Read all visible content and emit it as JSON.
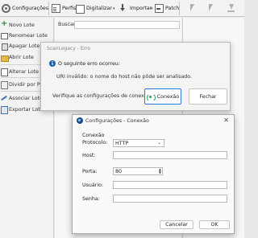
{
  "toolbar": {
    "configuracoes": "Configurações",
    "perfis": "Perfis",
    "digitalizar": "Digitalizar",
    "importar": "Importar",
    "patch": "Patch"
  },
  "sidebar": {
    "items": [
      {
        "label": "Novo Lote",
        "icon": "plus-icon"
      },
      {
        "label": "Renomear Lote",
        "icon": "rename-icon"
      },
      {
        "label": "Apagar Lote",
        "icon": "delete-icon"
      },
      {
        "label": "Abrir Lote",
        "icon": "folder-open-icon"
      },
      {
        "label": "Alterar Lote",
        "icon": "edit-icon"
      },
      {
        "label": "Dividir por PatchT",
        "icon": "divide-icon"
      },
      {
        "label": "Associar Lote",
        "icon": "link-icon"
      },
      {
        "label": "Exportar Lote",
        "icon": "export-icon"
      }
    ]
  },
  "search": {
    "label": "Buscar",
    "value": ""
  },
  "error_dialog": {
    "title": "ScanLegacy - Erro",
    "heading": "O seguinte erro ocorreu:",
    "message": "URI inválido: o nome do host não pôde ser analisado.",
    "verify_text": "Verifique as configurações de conexão.",
    "conexao_button": "Conexão",
    "fechar_button": "Fechar"
  },
  "config_dialog": {
    "title": "Configurações - Conexão",
    "group_label": "Conexão",
    "protocolo_label": "Protocolo:",
    "protocolo_value": "HTTP",
    "host_label": "Host:",
    "host_value": "",
    "porta_label": "Porta:",
    "porta_value": "80",
    "usuario_label": "Usuário:",
    "usuario_value": "",
    "senha_label": "Senha:",
    "senha_value": "",
    "cancelar_button": "Cancelar",
    "ok_button": "OK"
  },
  "colors": {
    "accent": "#2a7cd6",
    "info_icon": "#1f5fae"
  }
}
